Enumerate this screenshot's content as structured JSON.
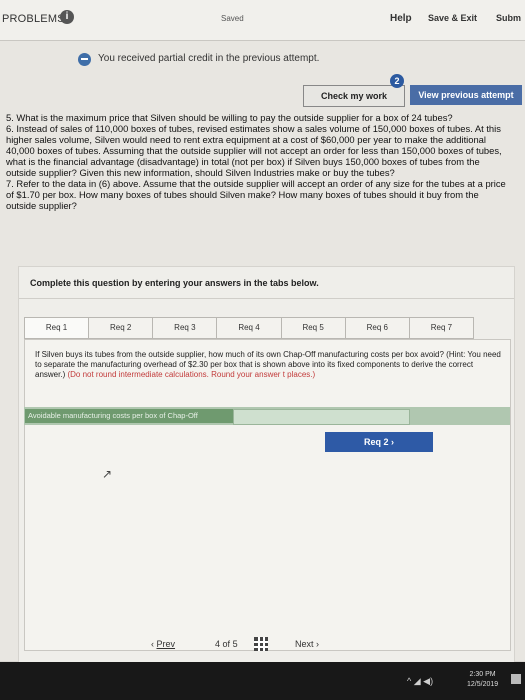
{
  "header": {
    "section_label": "PROBLEMS",
    "info_glyph": "i",
    "saved_text": "Saved",
    "help": "Help",
    "save_exit": "Save & Exit",
    "submit": "Subm"
  },
  "notice": "You received partial credit in the previous attempt.",
  "actions": {
    "check_label": "Check my work",
    "check_badge": "2",
    "view_previous_label": "View previous attempt"
  },
  "questions": [
    "5. What is the maximum price that Silven should be willing to pay the outside supplier for a box of 24 tubes?",
    "6. Instead of sales of 110,000 boxes of tubes, revised estimates show a sales volume of 150,000 boxes of tubes. At this higher sales volume, Silven would need to rent extra equipment at a cost of $60,000 per year to make the additional 40,000 boxes of tubes. Assuming that the outside supplier will not accept an order for less than 150,000 boxes of tubes, what is the financial advantage (disadvantage) in total (not per box) if Silven buys 150,000 boxes of tubes from the outside supplier? Given this new information, should Silven Industries make or buy the tubes?",
    "7. Refer to the data in (6) above. Assume that the outside supplier will accept an order of any size for the tubes at a price of $1.70 per box. How many boxes of tubes should Silven make? How many boxes of tubes should it buy from the outside supplier?"
  ],
  "card": {
    "title": "Complete this question by entering your answers in the tabs below.",
    "tabs": [
      "Req 1",
      "Req 2",
      "Req 3",
      "Req 4",
      "Req 5",
      "Req 6",
      "Req 7"
    ],
    "instruction_main": "If Silven buys its tubes from the outside supplier, how much of its own Chap-Off manufacturing costs per box avoid? (Hint: You need to separate the manufacturing overhead of $2.30 per box that is shown above into its fixed components to derive the correct answer.)",
    "instruction_red": "(Do not round intermediate calculations. Round your answer t places.)",
    "answer_label": "Avoidable manufacturing costs per box of Chap-Off",
    "answer_value": "",
    "next_req_label": "Req 2",
    "next_req_arrow": "›"
  },
  "pager": {
    "prev_arrow": "‹",
    "prev_label": "Prev",
    "current": "4",
    "of_text": "of",
    "total": "5",
    "next_label": "Next",
    "next_arrow": "›"
  },
  "taskbar": {
    "tray_icons": "^ ◢ ◀)",
    "time": "2:30 PM",
    "date": "12/5/2019"
  },
  "colors": {
    "primary_button": "#2e5aa6",
    "answer_row": "#6f9a6f",
    "instruction_red": "#c23b3b"
  }
}
